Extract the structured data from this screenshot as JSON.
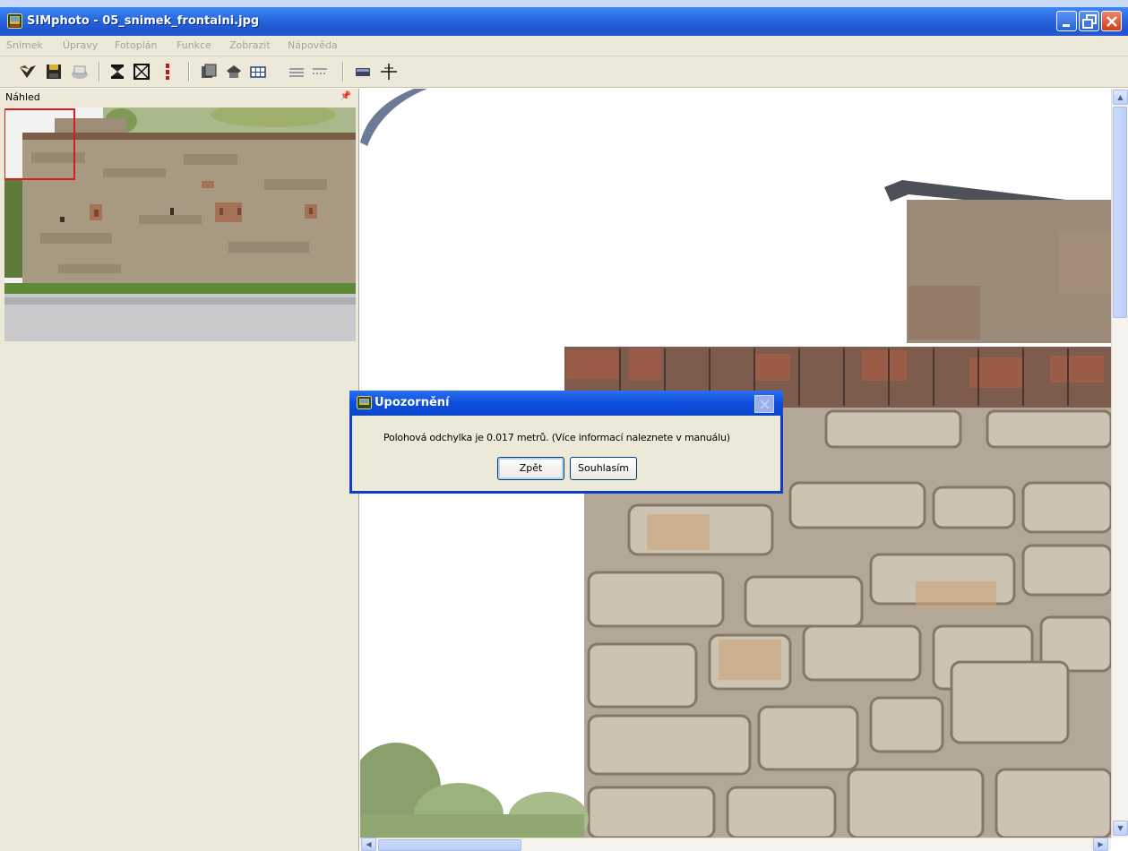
{
  "window": {
    "title": "SIMphoto - 05_snimek_frontalni.jpg",
    "icon": "app-icon",
    "controls": [
      "minimize-icon",
      "restore-icon",
      "close-icon"
    ]
  },
  "menu": {
    "items": [
      "Snímek",
      "Úpravy",
      "Fotoplán",
      "Funkce",
      "Zobrazit",
      "Nápověda"
    ]
  },
  "toolbar": {
    "icons": [
      "open-icon",
      "save-icon",
      "print-icon",
      "hourglass-points-icon",
      "clear-points-icon",
      "point-marker-icon",
      "layers-icon",
      "layers-alt-icon",
      "grid-icon",
      "horizontal-lines-icon",
      "dashed-lines-icon",
      "rectangle-icon",
      "crosshair-icon"
    ]
  },
  "preview": {
    "title": "Náhled",
    "pin_icon": "pin-icon"
  },
  "dialog": {
    "title": "Upozornění",
    "message": "Polohová odchylka je 0.017 metrů. (Více informací naleznete v manuálu)",
    "back_label": "Zpět",
    "agree_label": "Souhlasím"
  },
  "colors": {
    "title_bar": "#2a6ae0",
    "dialog_border": "#0b3ec9",
    "panel_bg": "#ece9d8",
    "selection_frame": "#d81d1d"
  }
}
